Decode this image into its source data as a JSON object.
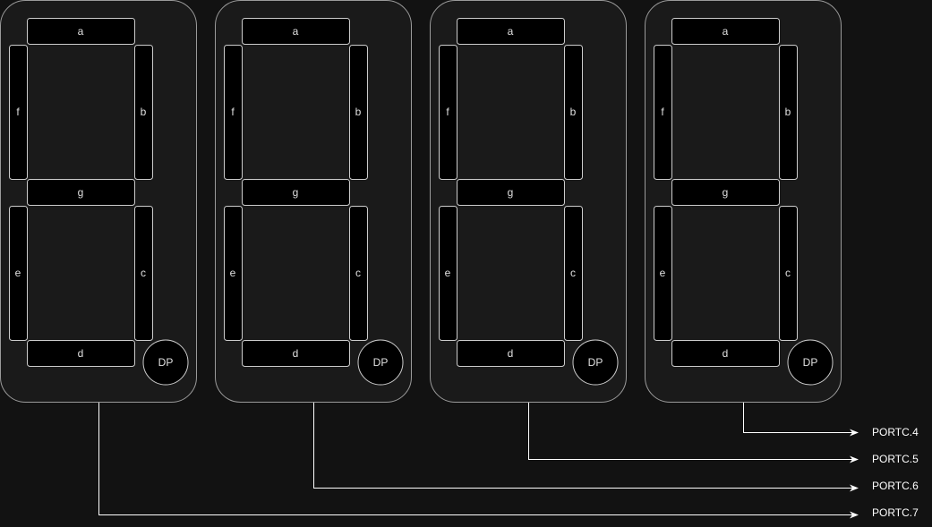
{
  "digits": [
    {
      "segments": {
        "a": "a",
        "b": "b",
        "c": "c",
        "d": "d",
        "e": "e",
        "f": "f",
        "g": "g"
      },
      "dp": "DP",
      "port": "PORTC.7"
    },
    {
      "segments": {
        "a": "a",
        "b": "b",
        "c": "c",
        "d": "d",
        "e": "e",
        "f": "f",
        "g": "g"
      },
      "dp": "DP",
      "port": "PORTC.6"
    },
    {
      "segments": {
        "a": "a",
        "b": "b",
        "c": "c",
        "d": "d",
        "e": "e",
        "f": "f",
        "g": "g"
      },
      "dp": "DP",
      "port": "PORTC.5"
    },
    {
      "segments": {
        "a": "a",
        "b": "b",
        "c": "c",
        "d": "d",
        "e": "e",
        "f": "f",
        "g": "g"
      },
      "dp": "DP",
      "port": "PORTC.4"
    }
  ],
  "colors": {
    "background": "#121212",
    "stroke": "#cccccc",
    "segment_fill": "#000000",
    "text": "#e0e0e0",
    "wire": "#ffffff"
  }
}
